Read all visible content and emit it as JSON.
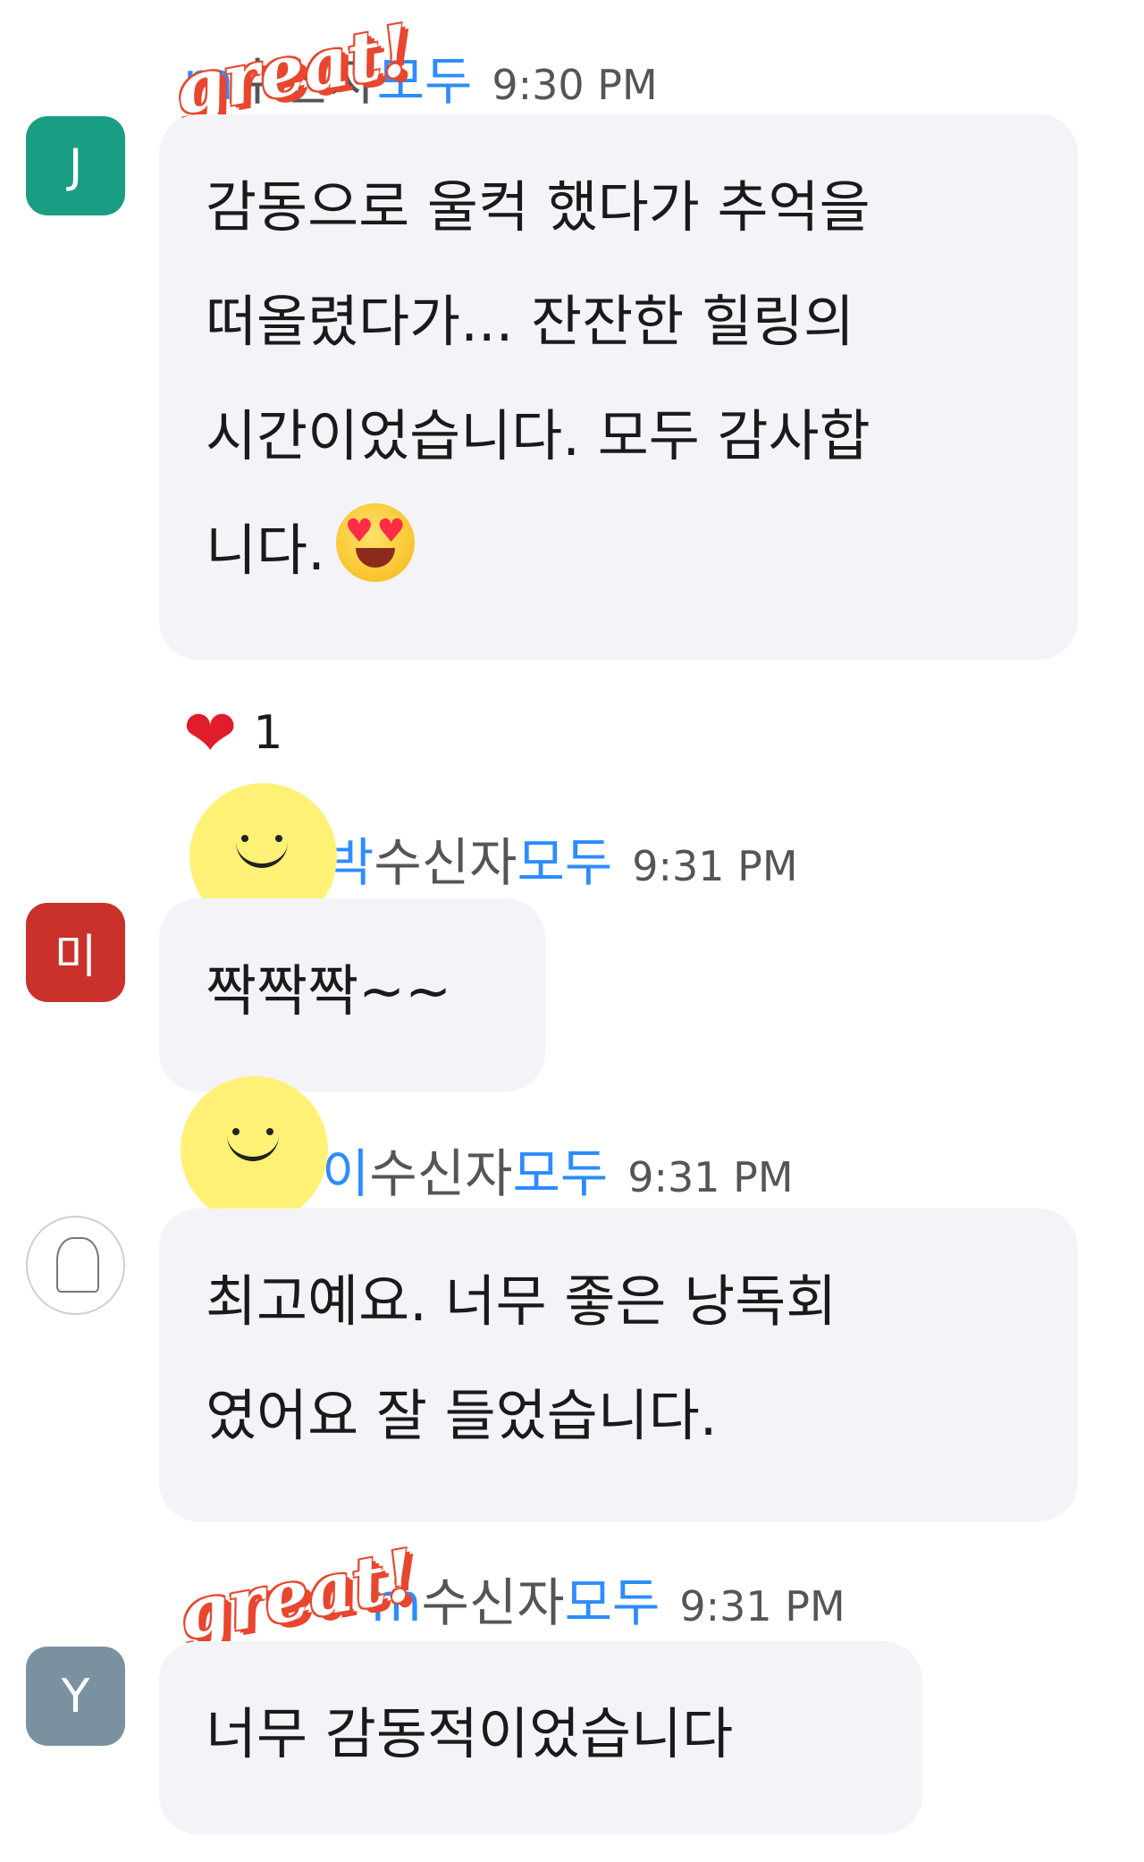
{
  "messages": [
    {
      "avatar_letter": "J",
      "avatar_color": "#1a9e83",
      "sender": "m",
      "recipient_label": "수신자",
      "recipient": "모두",
      "time": "9:30 PM",
      "lines": [
        "감동으로 울컥 했다가 추억을",
        "떠올렸다가... 잔잔한 힐링의",
        "시간이었습니다. 모두 감사합",
        "니다."
      ],
      "emoji": "star-struck-emoji"
    },
    {
      "avatar_letter": "미",
      "avatar_color": "#c9312a",
      "sender": "박",
      "recipient_label": "수신자",
      "recipient": "모두",
      "time": "9:31 PM",
      "lines": [
        "짝짝짝~~"
      ]
    },
    {
      "avatar_letter": "",
      "avatar_color": "#ffffff",
      "sender": "이",
      "recipient_label": "수신자",
      "recipient": "모두",
      "time": "9:31 PM",
      "lines": [
        "최고예요. 너무 좋은 낭독회",
        "였어요 잘 들었습니다."
      ]
    },
    {
      "avatar_letter": "Y",
      "avatar_color": "#7a92a0",
      "sender": "m",
      "recipient_label": "수신자",
      "recipient": "모두",
      "time": "9:31 PM",
      "lines": [
        "너무 감동적이었습니다"
      ]
    }
  ],
  "reaction": {
    "icon": "heart-icon",
    "count": "1"
  },
  "stickers": {
    "great": "great!"
  }
}
